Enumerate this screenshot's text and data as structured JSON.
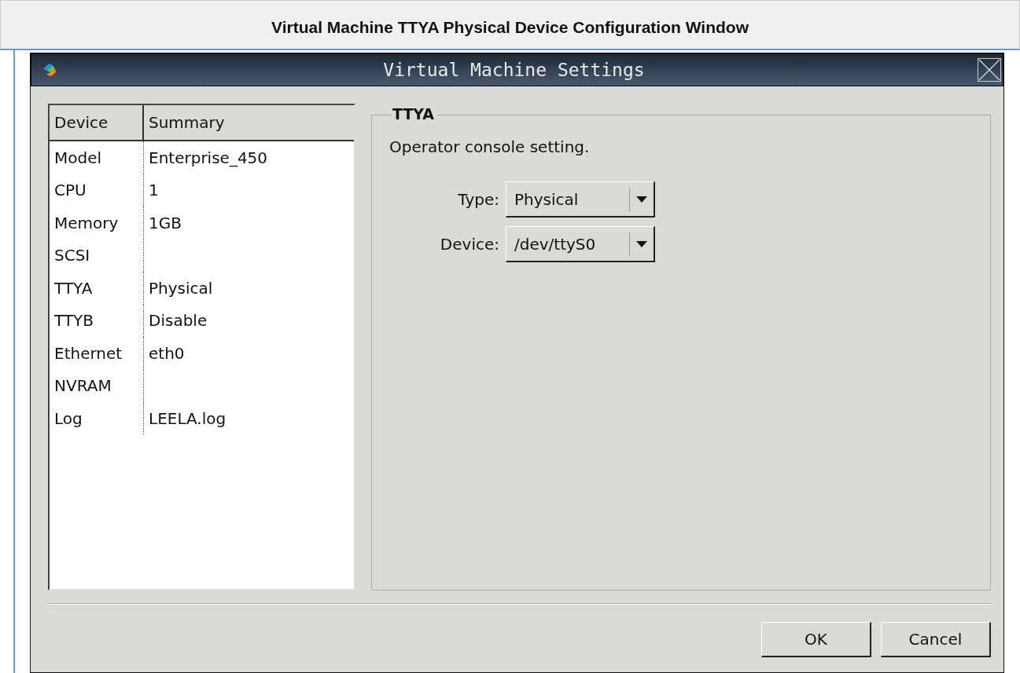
{
  "page_title": "Virtual Machine TTYA Physical Device Configuration Window",
  "window": {
    "title": "Virtual Machine Settings"
  },
  "table": {
    "columns": [
      "Device",
      "Summary"
    ],
    "rows": [
      [
        "Model",
        "Enterprise_450"
      ],
      [
        "CPU",
        "1"
      ],
      [
        "Memory",
        "1GB"
      ],
      [
        "SCSI",
        ""
      ],
      [
        "TTYA",
        "Physical"
      ],
      [
        "TTYB",
        "Disable"
      ],
      [
        "Ethernet",
        "eth0"
      ],
      [
        "NVRAM",
        ""
      ],
      [
        "Log",
        "LEELA.log"
      ]
    ]
  },
  "group": {
    "title": "TTYA",
    "description": "Operator console setting.",
    "fields": [
      {
        "label": "Type:",
        "value": "Physical"
      },
      {
        "label": "Device:",
        "value": "/dev/ttyS0"
      }
    ]
  },
  "buttons": [
    "OK",
    "Cancel"
  ]
}
